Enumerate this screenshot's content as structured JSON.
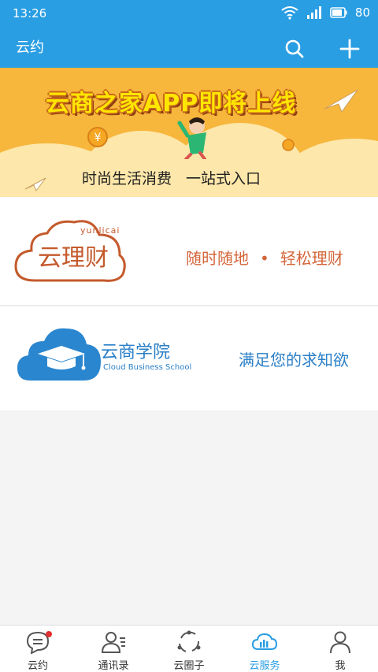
{
  "status_bar": {
    "time": "13:26",
    "battery": "80"
  },
  "app_bar": {
    "title": "云约"
  },
  "banner": {
    "title": "云商之家APP即将上线",
    "subtitle_left": "时尚生活消费",
    "subtitle_right": "一站式入口"
  },
  "licai": {
    "pinyin": "yunlicai",
    "name": "云理财",
    "slogan_left": "随时随地",
    "slogan_dot": "•",
    "slogan_right": "轻松理财",
    "color": "#c45a2c"
  },
  "xueyuan": {
    "name": "云商学院",
    "name_en": "Cloud Business School",
    "slogan": "满足您的求知欲",
    "color": "#2a7fc7"
  },
  "bottom_nav": {
    "items": [
      {
        "label": "云约",
        "icon": "chat-bubble-icon",
        "badge": true
      },
      {
        "label": "通讯录",
        "icon": "contacts-icon"
      },
      {
        "label": "云圈子",
        "icon": "circle-refresh-icon"
      },
      {
        "label": "云服务",
        "icon": "cloud-chart-icon",
        "active": true
      },
      {
        "label": "我",
        "icon": "person-icon"
      }
    ],
    "active_color": "#2a9ee3"
  },
  "colors": {
    "primary": "#2a9ee3",
    "banner": "#f7b63c"
  }
}
